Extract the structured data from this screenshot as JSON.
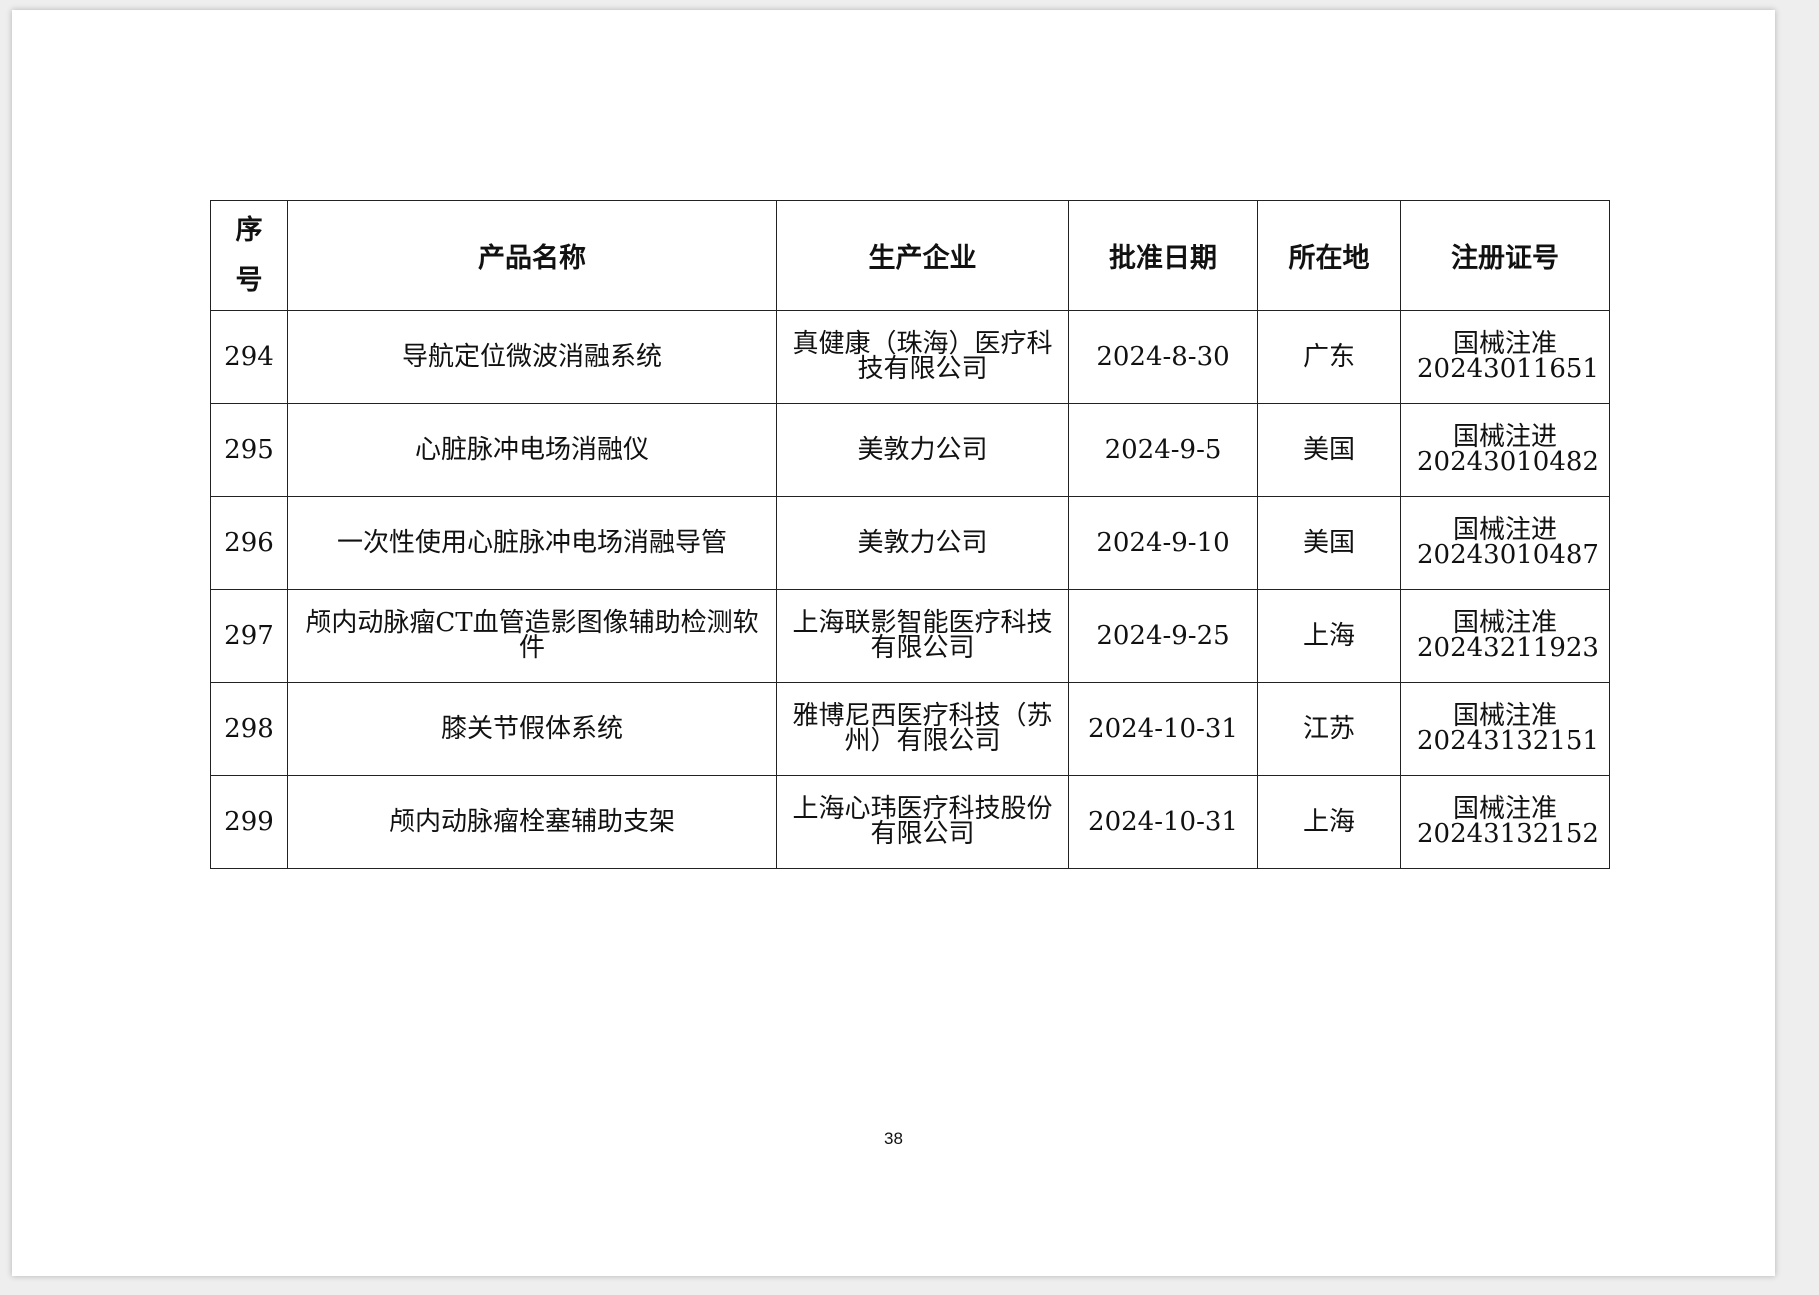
{
  "table": {
    "headers": {
      "seq_line1": "序",
      "seq_line2": "号",
      "product": "产品名称",
      "company": "生产企业",
      "date": "批准日期",
      "location": "所在地",
      "reg_no": "注册证号"
    },
    "rows": [
      {
        "seq": "294",
        "product": "导航定位微波消融系统",
        "company": "真健康（珠海）医疗科技有限公司",
        "date": "2024-8-30",
        "location": "广东",
        "reg_no": "国械注准20243011651"
      },
      {
        "seq": "295",
        "product": "心脏脉冲电场消融仪",
        "company": "美敦力公司",
        "date": "2024-9-5",
        "location": "美国",
        "reg_no": "国械注进20243010482"
      },
      {
        "seq": "296",
        "product": "一次性使用心脏脉冲电场消融导管",
        "company": "美敦力公司",
        "date": "2024-9-10",
        "location": "美国",
        "reg_no": "国械注进20243010487"
      },
      {
        "seq": "297",
        "product": "颅内动脉瘤CT血管造影图像辅助检测软件",
        "company": "上海联影智能医疗科技有限公司",
        "date": "2024-9-25",
        "location": "上海",
        "reg_no": "国械注准20243211923"
      },
      {
        "seq": "298",
        "product": "膝关节假体系统",
        "company": "雅博尼西医疗科技（苏州）有限公司",
        "date": "2024-10-31",
        "location": "江苏",
        "reg_no": "国械注准20243132151"
      },
      {
        "seq": "299",
        "product": "颅内动脉瘤栓塞辅助支架",
        "company": "上海心玮医疗科技股份有限公司",
        "date": "2024-10-31",
        "location": "上海",
        "reg_no": "国械注准20243132152"
      }
    ]
  },
  "page_number": "38"
}
